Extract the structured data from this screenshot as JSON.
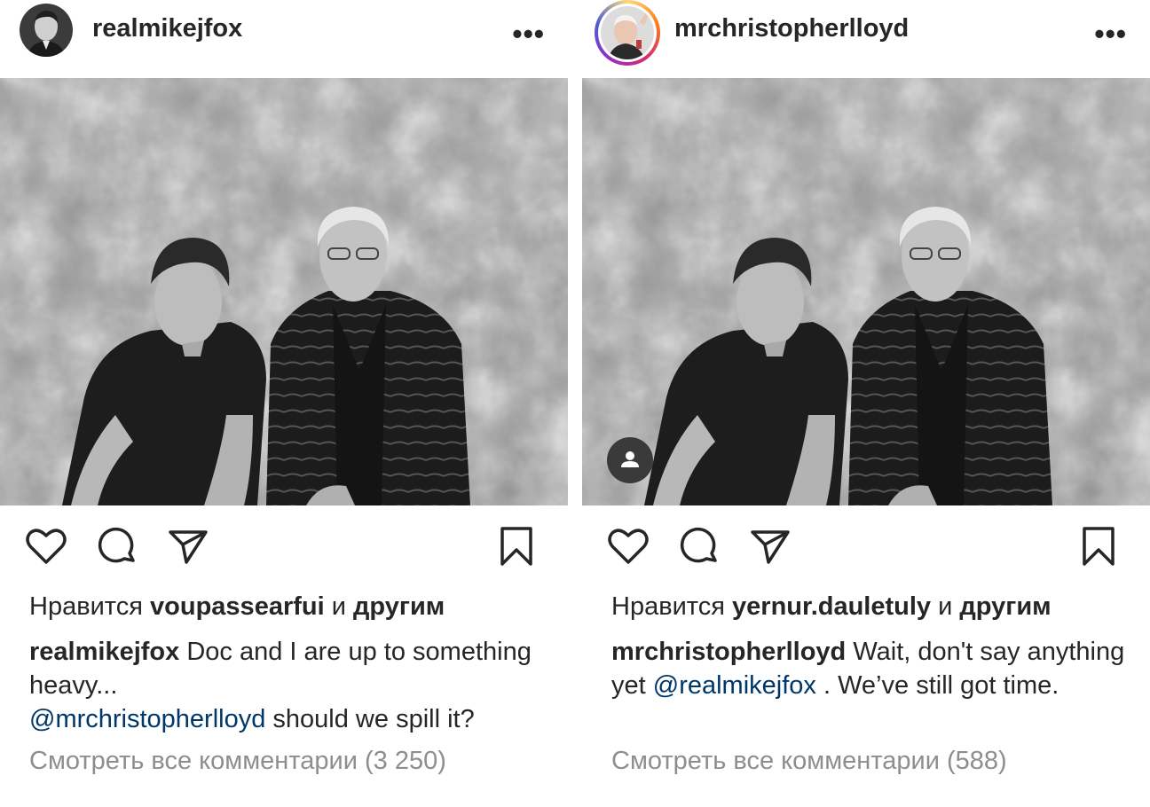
{
  "posts": [
    {
      "username": "realmikejfox",
      "likes_prefix": "Нравится",
      "likes_user": "voupassearfui",
      "likes_and": "и",
      "likes_others": "другим",
      "caption_user": "realmikejfox",
      "caption_part1": "Doc and I are up to something heavy...",
      "caption_mention": "@mrchristopherlloyd",
      "caption_part2": "should we spill it?",
      "view_comments": "Смотреть все комментарии (3 250)",
      "has_story_ring": false,
      "has_tag_button": false
    },
    {
      "username": "mrchristopherlloyd",
      "likes_prefix": "Нравится",
      "likes_user": "yernur.dauletuly",
      "likes_and": "и",
      "likes_others": "другим",
      "caption_user": "mrchristopherlloyd",
      "caption_part1": "Wait, don't say anything yet",
      "caption_mention": "@realmikejfox",
      "caption_part2": ". We’ve still got time.",
      "view_comments": "Смотреть все комментарии (588)",
      "has_story_ring": true,
      "has_tag_button": true
    }
  ],
  "icons": [
    "more-icon",
    "heart-icon",
    "comment-icon",
    "share-icon",
    "bookmark-icon",
    "user-tag-icon"
  ],
  "colors": {
    "text": "#262626",
    "mention": "#00376b",
    "muted": "#8e8e8e"
  }
}
